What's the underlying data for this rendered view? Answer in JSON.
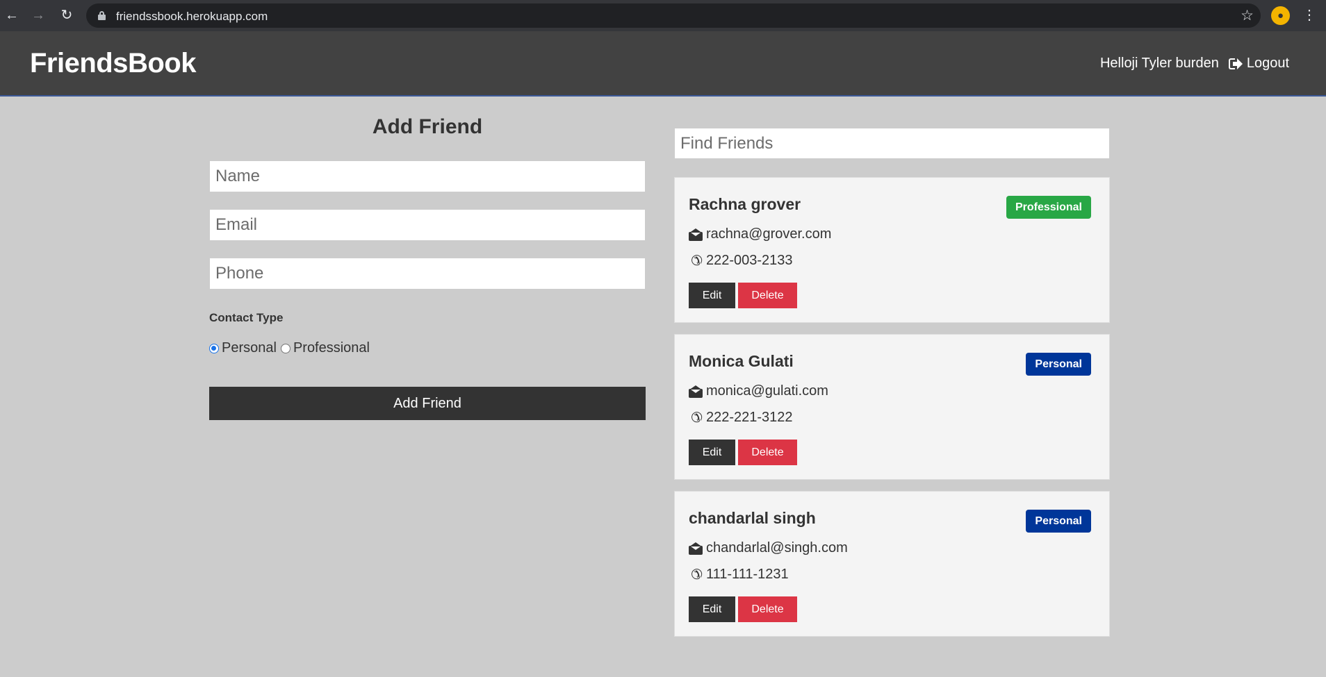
{
  "browser": {
    "url": "friendssbook.herokuapp.com",
    "icons": [
      "back-icon",
      "forward-icon",
      "reload-icon",
      "lock-icon",
      "star-icon",
      "profile-avatar",
      "menu-icon"
    ]
  },
  "navbar": {
    "brand": "FriendsBook",
    "greeting": "Helloji Tyler burden",
    "logout_label": "Logout"
  },
  "form": {
    "title": "Add Friend",
    "name_placeholder": "Name",
    "email_placeholder": "Email",
    "phone_placeholder": "Phone",
    "contact_type_label": "Contact Type",
    "options": [
      "Personal",
      "Professional"
    ],
    "selected_option": "Personal",
    "submit_label": "Add Friend"
  },
  "search": {
    "placeholder": "Find Friends"
  },
  "contacts": [
    {
      "name": "Rachna grover",
      "type": "Professional",
      "email": "rachna@grover.com",
      "phone": "222-003-2133",
      "edit_label": "Edit",
      "delete_label": "Delete"
    },
    {
      "name": "Monica Gulati",
      "type": "Personal",
      "email": "monica@gulati.com",
      "phone": "222-221-3122",
      "edit_label": "Edit",
      "delete_label": "Delete"
    },
    {
      "name": "chandarlal singh",
      "type": "Personal",
      "email": "chandarlal@singh.com",
      "phone": "111-111-1231",
      "edit_label": "Edit",
      "delete_label": "Delete"
    }
  ],
  "colors": {
    "page_bg": "#cccccc",
    "navbar_bg": "#424242",
    "dark_button": "#333333",
    "delete_button": "#dc3545",
    "badge_professional": "#28a745",
    "badge_personal": "#003699",
    "card_bg": "#f4f4f4"
  }
}
